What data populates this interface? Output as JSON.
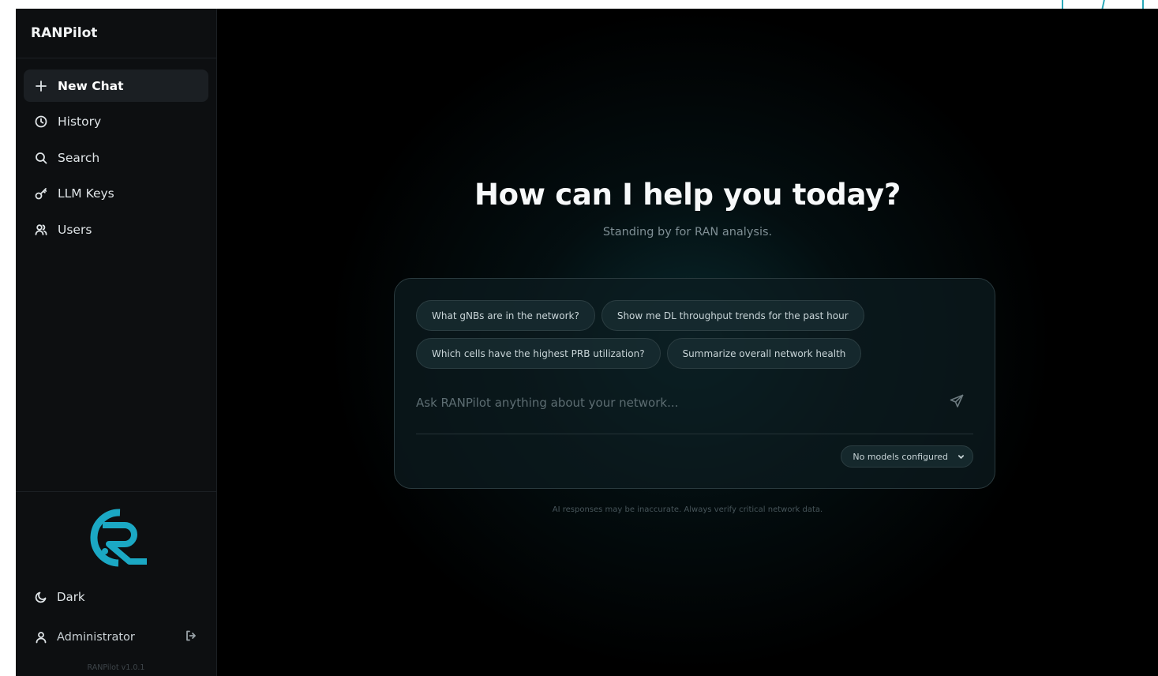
{
  "app": {
    "brand": "RANPilot",
    "version": "RANPilot v1.0.1"
  },
  "sidebar": {
    "items": [
      {
        "label": "New Chat",
        "icon": "plus-icon",
        "active": true
      },
      {
        "label": "History",
        "icon": "clock-icon"
      },
      {
        "label": "Search",
        "icon": "search-icon"
      },
      {
        "label": "LLM Keys",
        "icon": "key-icon"
      },
      {
        "label": "Users",
        "icon": "users-icon"
      }
    ],
    "theme_label": "Dark",
    "user_label": "Administrator"
  },
  "main": {
    "headline": "How can I help you today?",
    "subline": "Standing by for RAN analysis.",
    "suggestions": [
      "What gNBs are in the network?",
      "Show me DL throughput trends for the past hour",
      "Which cells have the highest PRB utilization?",
      "Summarize overall network health"
    ],
    "input_placeholder": "Ask RANPilot anything about your network...",
    "model_selector": "No models configured",
    "disclaimer": "AI responses may be inaccurate. Always verify critical network data."
  },
  "colors": {
    "accent": "#1ba8c4",
    "background": "#000000",
    "sidebar": "#0d0f11"
  }
}
